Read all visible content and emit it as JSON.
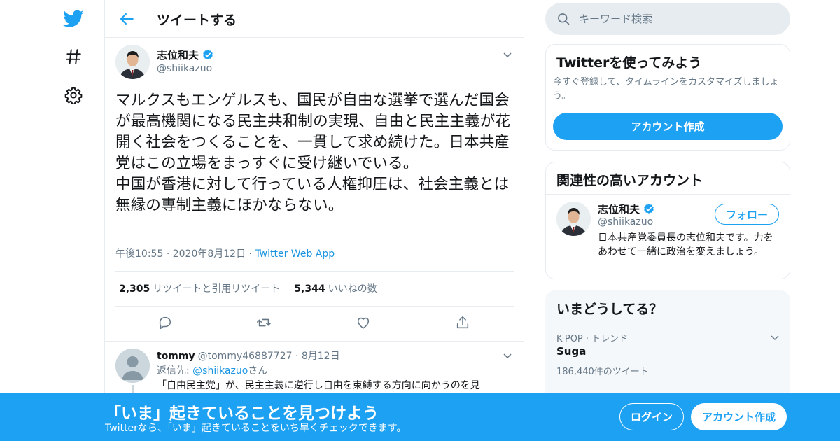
{
  "colors": {
    "accent": "#1da1f2",
    "text": "#14171a",
    "secondary": "#657786",
    "border": "#e6ecf0"
  },
  "header": {
    "title": "ツイートする"
  },
  "tweet": {
    "author_name": "志位和夫",
    "author_handle": "@shiikazuo",
    "text": "マルクスもエンゲルスも、国民が自由な選挙で選んだ国会が最高機関になる民主共和制の実現、自由と民主主義が花開く社会をつくることを、一貫して求め続けた。日本共産党はこの立場をまっすぐに受け継いでいる。\n中国が香港に対して行っている人権抑圧は、社会主義とは無縁の専制主義にほかならない。",
    "time": "午後10:55",
    "date": "2020年8月12日",
    "source": "Twitter Web App",
    "retweet_count": "2,305",
    "retweet_label": "リツイートと引用リツイート",
    "like_count": "5,344",
    "like_label": "いいねの数"
  },
  "reply": {
    "name": "tommy",
    "handle": "@tommy46887727",
    "date": "8月12日",
    "reply_to_prefix": "返信先: ",
    "reply_to_handle": "@shiikazuo",
    "reply_to_suffix": "さん",
    "text": "「自由民主党」が、民主主義に逆行し自由を束縛する方向に向かうのを見"
  },
  "search": {
    "placeholder": "キーワード検索"
  },
  "signup_card": {
    "title": "Twitterを使ってみよう",
    "subtitle": "今すぐ登録して、タイムラインをカスタマイズしましょう。",
    "button": "アカウント作成"
  },
  "related": {
    "title": "関連性の高いアカウント",
    "name": "志位和夫",
    "handle": "@shiikazuo",
    "bio": "日本共産党委員長の志位和夫です。力をあわせて一緒に政治を変えましょう。",
    "follow_label": "フォロー"
  },
  "trends": {
    "title": "いまどうしてる？",
    "meta": "K-POP · トレンド",
    "name": "Suga",
    "count": "186,440件のツイート"
  },
  "banner": {
    "title": "「いま」起きていることを見つけよう",
    "subtitle": "Twitterなら、「いま」起きていることをいち早くチェックできます。",
    "login": "ログイン",
    "signup": "アカウント作成"
  }
}
